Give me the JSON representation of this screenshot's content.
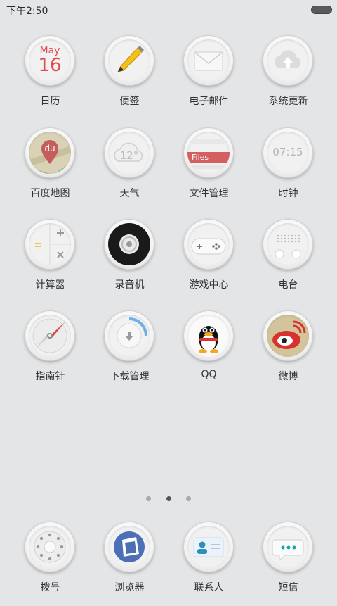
{
  "status_bar": {
    "time": "下午2:50"
  },
  "apps": [
    {
      "id": "calendar",
      "label": "日历",
      "icon": "calendar-icon",
      "month": "May",
      "day": "16"
    },
    {
      "id": "notes",
      "label": "便签",
      "icon": "pencil-icon"
    },
    {
      "id": "email",
      "label": "电子邮件",
      "icon": "envelope-icon"
    },
    {
      "id": "system-update",
      "label": "系统更新",
      "icon": "cloud-upload-icon"
    },
    {
      "id": "baidu-map",
      "label": "百度地图",
      "icon": "map-pin-icon",
      "badge": "du"
    },
    {
      "id": "weather",
      "label": "天气",
      "icon": "cloud-icon",
      "temp": "12°"
    },
    {
      "id": "file-manager",
      "label": "文件管理",
      "icon": "folder-icon",
      "tab": "Files"
    },
    {
      "id": "clock",
      "label": "时钟",
      "icon": "clock-icon",
      "time": "07:15"
    },
    {
      "id": "calculator",
      "label": "计算器",
      "icon": "calculator-icon"
    },
    {
      "id": "recorder",
      "label": "录音机",
      "icon": "reel-icon"
    },
    {
      "id": "game-center",
      "label": "游戏中心",
      "icon": "gamepad-icon"
    },
    {
      "id": "radio",
      "label": "电台",
      "icon": "radio-icon"
    },
    {
      "id": "compass",
      "label": "指南针",
      "icon": "compass-icon"
    },
    {
      "id": "download-manager",
      "label": "下载管理",
      "icon": "download-icon"
    },
    {
      "id": "qq",
      "label": "QQ",
      "icon": "penguin-icon"
    },
    {
      "id": "weibo",
      "label": "微博",
      "icon": "weibo-icon"
    }
  ],
  "page_indicator": {
    "count": 3,
    "active": 1
  },
  "dock": [
    {
      "id": "dialer",
      "label": "拨号",
      "icon": "dialpad-icon"
    },
    {
      "id": "browser",
      "label": "浏览器",
      "icon": "browser-icon"
    },
    {
      "id": "contacts",
      "label": "联系人",
      "icon": "contact-card-icon"
    },
    {
      "id": "messages",
      "label": "短信",
      "icon": "chat-bubble-icon"
    }
  ]
}
